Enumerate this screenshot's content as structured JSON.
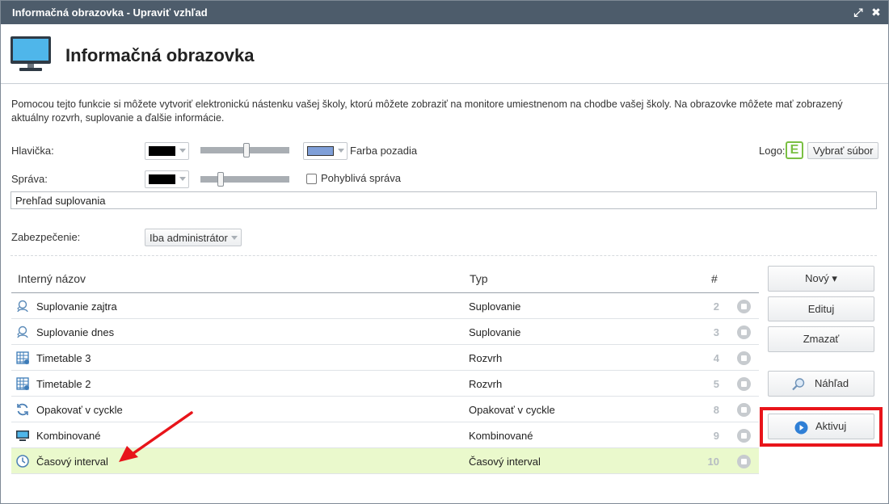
{
  "window": {
    "title": "Informačná obrazovka - Upraviť vzhľad",
    "expand_icon": "⤢",
    "close_icon": "✖"
  },
  "header": {
    "title": "Informačná obrazovka"
  },
  "description": "Pomocou tejto funkcie si môžete vytvoriť elektronickú nástenku vašej školy, ktorú môžete zobraziť na monitore umiestnenom na chodbe vašej školy. Na obrazovke môžete mať zobrazený aktuálny rozvrh, suplovanie a ďalšie informácie.",
  "form": {
    "header_label": "Hlavička:",
    "header_text_color": "#000000",
    "header_bg_color": "#7f9fd8",
    "bg_color_label": "Farba pozadia",
    "logo_label": "Logo:",
    "logo_letter": "E",
    "choose_file": "Vybrať súbor",
    "message_label": "Správa:",
    "message_color": "#000000",
    "moving_message_label": "Pohyblivá správa",
    "message_value": "Prehľad suplovania",
    "security_label": "Zabezpečenie:",
    "security_value": "Iba administrátor"
  },
  "table": {
    "columns": {
      "name": "Interný názov",
      "type": "Typ",
      "num": "#"
    },
    "rows": [
      {
        "name": "Suplovanie zajtra",
        "type": "Suplovanie",
        "num": "2",
        "icon": "substitution-icon"
      },
      {
        "name": "Suplovanie dnes",
        "type": "Suplovanie",
        "num": "3",
        "icon": "substitution-icon"
      },
      {
        "name": "Timetable 3",
        "type": "Rozvrh",
        "num": "4",
        "icon": "timetable-icon"
      },
      {
        "name": "Timetable 2",
        "type": "Rozvrh",
        "num": "5",
        "icon": "timetable-icon"
      },
      {
        "name": "Opakovať v cyckle",
        "type": "Opakovať v cyckle",
        "num": "8",
        "icon": "cycle-icon"
      },
      {
        "name": "Kombinované",
        "type": "Kombinované",
        "num": "9",
        "icon": "monitor-icon"
      },
      {
        "name": "Časový interval",
        "type": "Časový interval",
        "num": "10",
        "icon": "clock-icon"
      }
    ]
  },
  "actions": {
    "new": "Nový ▾",
    "edit": "Edituj",
    "delete": "Zmazať",
    "preview": "Náhľad",
    "activate": "Aktivuj"
  },
  "colors": {
    "highlight_row": "#eaf9cc",
    "annotation_red": "#e8141a",
    "titlebar": "#4d5c6b"
  }
}
